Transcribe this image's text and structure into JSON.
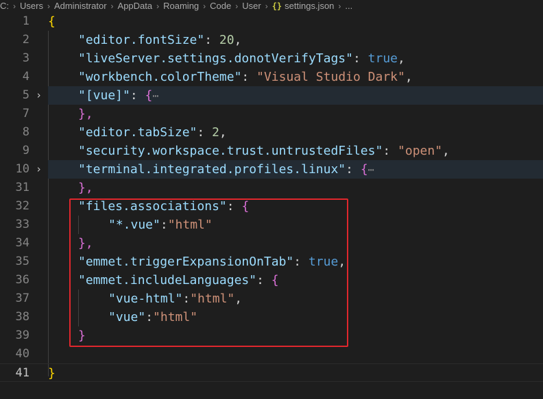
{
  "breadcrumb": {
    "segments": [
      "C:",
      "Users",
      "Administrator",
      "AppData",
      "Roaming",
      "Code",
      "User"
    ],
    "file_icon": "{}",
    "file": "settings.json",
    "more": "..."
  },
  "lines": [
    {
      "n": "1",
      "text": "{"
    },
    {
      "n": "2",
      "key": "\"editor.fontSize\"",
      "value": "20",
      "sep": ": ",
      "end": ","
    },
    {
      "n": "3",
      "key": "\"liveServer.settings.donotVerifyTags\"",
      "value": "true",
      "sep": ": ",
      "end": ","
    },
    {
      "n": "4",
      "key": "\"workbench.colorTheme\"",
      "value": "\"Visual Studio Dark\"",
      "sep": ": ",
      "end": ","
    },
    {
      "n": "5",
      "key": "\"[vue]\"",
      "sep": ": ",
      "brace": "{",
      "ellipsis": "⋯"
    },
    {
      "n": "7",
      "text": "},"
    },
    {
      "n": "8",
      "key": "\"editor.tabSize\"",
      "value": "2",
      "sep": ": ",
      "end": ","
    },
    {
      "n": "9",
      "key": "\"security.workspace.trust.untrustedFiles\"",
      "value": "\"open\"",
      "sep": ": ",
      "end": ","
    },
    {
      "n": "10",
      "key": "\"terminal.integrated.profiles.linux\"",
      "sep": ": ",
      "brace": "{",
      "ellipsis": "⋯"
    },
    {
      "n": "31",
      "text": "},"
    },
    {
      "n": "32",
      "key": "\"files.associations\"",
      "sep": ": ",
      "brace": "{"
    },
    {
      "n": "33",
      "key": "\"*.vue\"",
      "value": "\"html\"",
      "sep": ":"
    },
    {
      "n": "34",
      "text": "},"
    },
    {
      "n": "35",
      "key": "\"emmet.triggerExpansionOnTab\"",
      "value": "true",
      "sep": ": ",
      "end": ","
    },
    {
      "n": "36",
      "key": "\"emmet.includeLanguages\"",
      "sep": ": ",
      "brace": "{"
    },
    {
      "n": "37",
      "key": "\"vue-html\"",
      "value": "\"html\"",
      "sep": ":",
      "end": ","
    },
    {
      "n": "38",
      "key": "\"vue\"",
      "value": "\"html\"",
      "sep": ":"
    },
    {
      "n": "39",
      "text": "}"
    },
    {
      "n": "40",
      "text": ""
    },
    {
      "n": "41",
      "text": "}"
    }
  ],
  "fold_icon": "chevron-right-icon",
  "colors": {
    "highlight_box": "#e0272d",
    "key": "#9cdcfe",
    "string": "#ce9178",
    "number": "#b5cea8",
    "boolean": "#569cd6"
  }
}
